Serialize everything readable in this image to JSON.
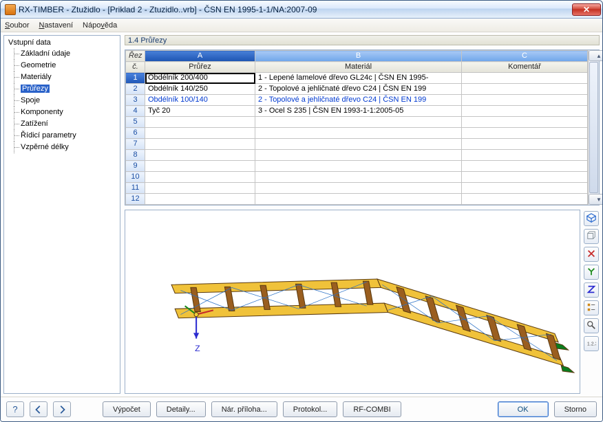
{
  "window": {
    "title": "RX-TIMBER - Ztužidlo - [Priklad 2 - Ztuzidlo..vrb] - ČSN EN 1995-1-1/NA:2007-09"
  },
  "menu": {
    "file": "Soubor",
    "settings": "Nastavení",
    "help": "Nápověda"
  },
  "tree": {
    "root": "Vstupní data",
    "items": [
      "Základní údaje",
      "Geometrie",
      "Materiály",
      "Průřezy",
      "Spoje",
      "Komponenty",
      "Zatížení",
      "Řídicí parametry",
      "Vzpěrné délky"
    ],
    "selected_index": 3
  },
  "panel_title": "1.4 Průřezy",
  "table": {
    "corner_top": "Řez",
    "corner_bottom": "č.",
    "letters": [
      "A",
      "B",
      "C"
    ],
    "headers": [
      "Průřez",
      "Materiál",
      "Komentář"
    ],
    "rows": [
      {
        "n": "1",
        "a": "Obdélník 200/400",
        "b": "1 - Lepené lamelové dřevo GL24c | ČSN EN 1995-",
        "c": ""
      },
      {
        "n": "2",
        "a": "Obdélník 140/250",
        "b": "2 - Topolové a jehličnaté dřevo C24 | ČSN EN 199",
        "c": ""
      },
      {
        "n": "3",
        "a": "Obdélník 100/140",
        "b": "2 - Topolové a jehličnaté dřevo C24 | ČSN EN 199",
        "c": ""
      },
      {
        "n": "4",
        "a": "Tyč 20",
        "b": "3 - Ocel S 235 | ČSN EN 1993-1-1:2005-05",
        "c": ""
      }
    ],
    "total_visible_rows": 12,
    "selected_row": 1,
    "highlight_row": 3
  },
  "viewport": {
    "axis_z_label": "Z"
  },
  "side_toolbar": {
    "items": [
      {
        "name": "isometric-view-icon",
        "color": "#2b6bd0"
      },
      {
        "name": "cube-view-icon",
        "color": "#7a878f"
      },
      {
        "name": "axis-x-icon",
        "color": "#c62a2a"
      },
      {
        "name": "axis-y-icon",
        "color": "#1a8a1a"
      },
      {
        "name": "axis-z-icon",
        "color": "#2b2bd0"
      },
      {
        "name": "legend-icon",
        "color": "#d08a1a"
      },
      {
        "name": "zoom-icon",
        "color": "#555"
      },
      {
        "name": "detail-123-icon",
        "color": "#555"
      }
    ]
  },
  "bottom": {
    "icon_help": "?",
    "buttons": {
      "calculate": "Výpočet",
      "details": "Detaily...",
      "nat_annex": "Nár. příloha...",
      "protocol": "Protokol...",
      "rfcombi": "RF-COMBI",
      "ok": "OK",
      "cancel": "Storno"
    }
  }
}
